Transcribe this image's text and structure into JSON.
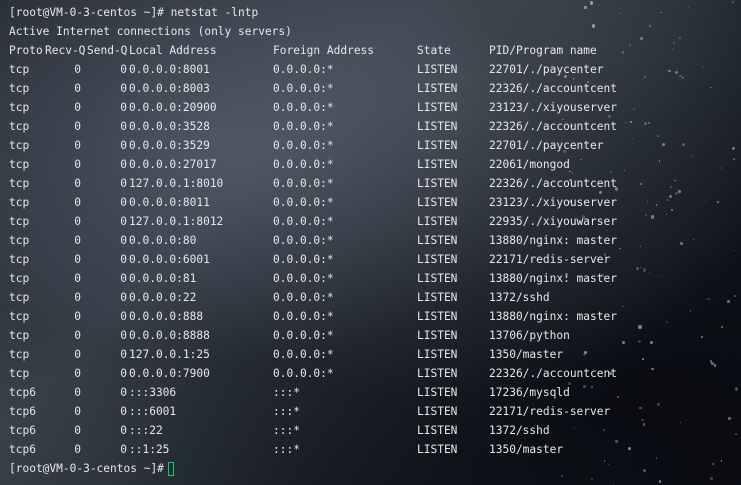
{
  "terminal": {
    "command_line": "[root@VM-0-3-centos ~]# netstat -lntp",
    "info_line": "Active Internet connections (only servers)",
    "headers": {
      "proto": "Proto",
      "recv": "Recv-Q",
      "send": "Send-Q",
      "local": "Local Address",
      "foreign": "Foreign Address",
      "state": "State",
      "pid": "PID/Program name"
    },
    "rows": [
      {
        "proto": "tcp",
        "recv": "0",
        "send": "0",
        "local": "0.0.0.0:8001",
        "foreign": "0.0.0.0:*",
        "state": "LISTEN",
        "pid": "22701/./paycenter"
      },
      {
        "proto": "tcp",
        "recv": "0",
        "send": "0",
        "local": "0.0.0.0:8003",
        "foreign": "0.0.0.0:*",
        "state": "LISTEN",
        "pid": "22326/./accountcent"
      },
      {
        "proto": "tcp",
        "recv": "0",
        "send": "0",
        "local": "0.0.0.0:20900",
        "foreign": "0.0.0.0:*",
        "state": "LISTEN",
        "pid": "23123/./xiyouserver"
      },
      {
        "proto": "tcp",
        "recv": "0",
        "send": "0",
        "local": "0.0.0.0:3528",
        "foreign": "0.0.0.0:*",
        "state": "LISTEN",
        "pid": "22326/./accountcent"
      },
      {
        "proto": "tcp",
        "recv": "0",
        "send": "0",
        "local": "0.0.0.0:3529",
        "foreign": "0.0.0.0:*",
        "state": "LISTEN",
        "pid": "22701/./paycenter"
      },
      {
        "proto": "tcp",
        "recv": "0",
        "send": "0",
        "local": "0.0.0.0:27017",
        "foreign": "0.0.0.0:*",
        "state": "LISTEN",
        "pid": "22061/mongod"
      },
      {
        "proto": "tcp",
        "recv": "0",
        "send": "0",
        "local": "127.0.0.1:8010",
        "foreign": "0.0.0.0:*",
        "state": "LISTEN",
        "pid": "22326/./accountcent"
      },
      {
        "proto": "tcp",
        "recv": "0",
        "send": "0",
        "local": "0.0.0.0:8011",
        "foreign": "0.0.0.0:*",
        "state": "LISTEN",
        "pid": "23123/./xiyouserver"
      },
      {
        "proto": "tcp",
        "recv": "0",
        "send": "0",
        "local": "127.0.0.1:8012",
        "foreign": "0.0.0.0:*",
        "state": "LISTEN",
        "pid": "22935/./xiyouwarser"
      },
      {
        "proto": "tcp",
        "recv": "0",
        "send": "0",
        "local": "0.0.0.0:80",
        "foreign": "0.0.0.0:*",
        "state": "LISTEN",
        "pid": "13880/nginx: master"
      },
      {
        "proto": "tcp",
        "recv": "0",
        "send": "0",
        "local": "0.0.0.0:6001",
        "foreign": "0.0.0.0:*",
        "state": "LISTEN",
        "pid": "22171/redis-server"
      },
      {
        "proto": "tcp",
        "recv": "0",
        "send": "0",
        "local": "0.0.0.0:81",
        "foreign": "0.0.0.0:*",
        "state": "LISTEN",
        "pid": "13880/nginx: master"
      },
      {
        "proto": "tcp",
        "recv": "0",
        "send": "0",
        "local": "0.0.0.0:22",
        "foreign": "0.0.0.0:*",
        "state": "LISTEN",
        "pid": "1372/sshd"
      },
      {
        "proto": "tcp",
        "recv": "0",
        "send": "0",
        "local": "0.0.0.0:888",
        "foreign": "0.0.0.0:*",
        "state": "LISTEN",
        "pid": "13880/nginx: master"
      },
      {
        "proto": "tcp",
        "recv": "0",
        "send": "0",
        "local": "0.0.0.0:8888",
        "foreign": "0.0.0.0:*",
        "state": "LISTEN",
        "pid": "13706/python"
      },
      {
        "proto": "tcp",
        "recv": "0",
        "send": "0",
        "local": "127.0.0.1:25",
        "foreign": "0.0.0.0:*",
        "state": "LISTEN",
        "pid": "1350/master"
      },
      {
        "proto": "tcp",
        "recv": "0",
        "send": "0",
        "local": "0.0.0.0:7900",
        "foreign": "0.0.0.0:*",
        "state": "LISTEN",
        "pid": "22326/./accountcent"
      },
      {
        "proto": "tcp6",
        "recv": "0",
        "send": "0",
        "local": ":::3306",
        "foreign": ":::*",
        "state": "LISTEN",
        "pid": "17236/mysqld"
      },
      {
        "proto": "tcp6",
        "recv": "0",
        "send": "0",
        "local": ":::6001",
        "foreign": ":::*",
        "state": "LISTEN",
        "pid": "22171/redis-server"
      },
      {
        "proto": "tcp6",
        "recv": "0",
        "send": "0",
        "local": ":::22",
        "foreign": ":::*",
        "state": "LISTEN",
        "pid": "1372/sshd"
      },
      {
        "proto": "tcp6",
        "recv": "0",
        "send": "0",
        "local": "::1:25",
        "foreign": ":::*",
        "state": "LISTEN",
        "pid": "1350/master"
      }
    ],
    "prompt": "[root@VM-0-3-centos ~]#",
    "colors": {
      "text": "#e8e8e8",
      "cursor": "#22c55e"
    }
  }
}
